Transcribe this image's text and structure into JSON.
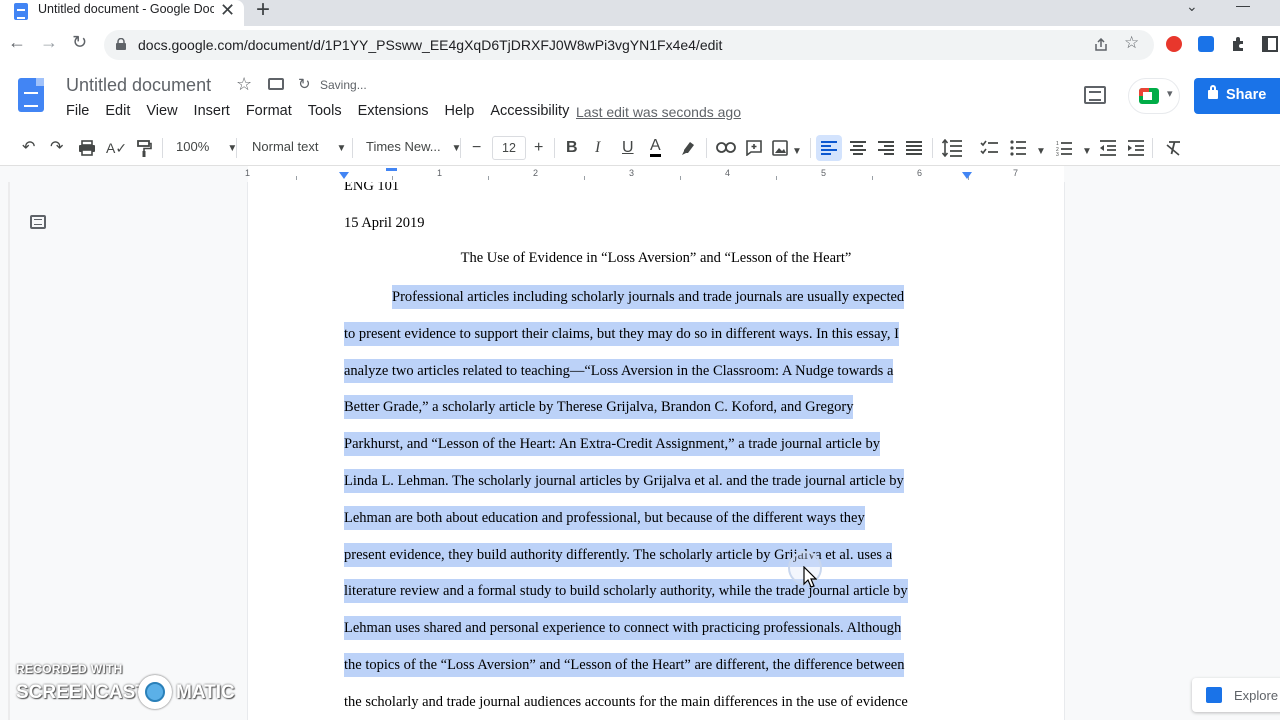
{
  "browser": {
    "tab_title": "Untitled document - Google Docs",
    "tab_close": "✕",
    "new_tab": "+",
    "url": "docs.google.com/document/d/1P1YY_PSsww_EE4gXqD6TjDRXFJ0W8wPi3vgYN1Fx4e4/edit"
  },
  "docs_header": {
    "title": "Untitled document",
    "saving_status": "Saving...",
    "menu": [
      "File",
      "Edit",
      "View",
      "Insert",
      "Format",
      "Tools",
      "Extensions",
      "Help",
      "Accessibility"
    ],
    "last_edit": "Last edit was seconds ago",
    "share_label": "Share"
  },
  "toolbar": {
    "zoom": "100%",
    "style": "Normal text",
    "font": "Times New...",
    "font_size": "12",
    "minus": "−",
    "plus": "+",
    "bold": "B",
    "italic": "I",
    "underline": "U",
    "text_color": "A"
  },
  "ruler": {
    "numbers": [
      "1",
      "1",
      "2",
      "3",
      "4",
      "5",
      "6",
      "7"
    ]
  },
  "document": {
    "lines": [
      "ENG 101",
      "15 April 2019"
    ],
    "essay_title": "The Use of Evidence in “Loss Aversion” and “Lesson of the Heart”",
    "selected_lines": [
      "Professional articles including scholarly journals and trade journals are usually expected",
      "to present evidence to support their claims, but they may do so in different ways. In this essay, I",
      "analyze two articles related to teaching—“Loss Aversion in the Classroom: A Nudge towards a",
      "Better Grade,” a scholarly article by Therese Grijalva, Brandon C. Koford, and Gregory",
      "Parkhurst, and “Lesson of the Heart: An Extra-Credit Assignment,” a trade journal article by",
      "Linda L. Lehman.  The scholarly journal articles by Grijalva et al. and the trade journal article by",
      "Lehman are both about education and professional, but because of the different ways they",
      "present evidence, they build authority differently. The scholarly article by Grijalva et al. uses a",
      "literature review and a formal study to build scholarly authority, while the trade journal article by",
      "Lehman uses shared and personal experience to connect with practicing professionals. Although",
      "the topics of the “Loss Aversion” and “Lesson of the Heart” are different, the difference between"
    ],
    "last_line": "the scholarly and trade journal audiences accounts for the main differences in the use of evidence"
  },
  "explore_label": "Explore",
  "watermark": {
    "line1": "RECORDED WITH",
    "line2a": "SCREENCAST",
    "line2b": "MATIC"
  },
  "colors": {
    "accent": "#1a73e8",
    "selection": "#bcd2f8"
  }
}
